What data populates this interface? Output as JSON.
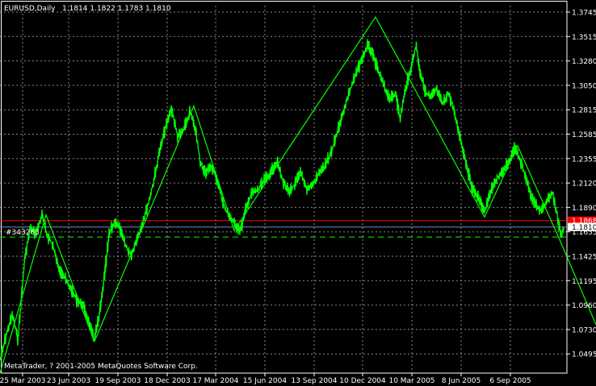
{
  "header": {
    "symbol_timeframe": "EURUSD,Daily",
    "ohlc": "1.1814 1.1822 1.1783 1.1810"
  },
  "copyright": "MetaTrader, ? 2001-2005 MetaQuotes Software Corp.",
  "order_label": "#343263",
  "price_labels": {
    "red_line": "1.1868",
    "current": "1.1810"
  },
  "colors": {
    "background": "#000000",
    "price_series": "#00ff00",
    "grid": "#b4b4b4",
    "axis_text": "#ffffff",
    "red_line": "#ff0000",
    "current_line": "#6a8fc7",
    "dashed_level": "#00ff00"
  },
  "chart_data": {
    "type": "line",
    "grid": true,
    "x_tick_labels": [
      "25 Mar 2003",
      "23 Jun 2003",
      "19 Sep 2003",
      "18 Dec 2003",
      "17 Mar 2004",
      "15 Jun 2004",
      "13 Sep 2004",
      "10 Dec 2004",
      "10 Mar 2005",
      "8 Jun 2005",
      "6 Sep 2005"
    ],
    "y_tick_labels": [
      "1.3745",
      "1.3515",
      "1.3280",
      "1.3050",
      "1.2815",
      "1.2585",
      "1.2355",
      "1.2120",
      "1.1890",
      "1.1655",
      "1.1425",
      "1.1195",
      "1.0960",
      "1.0730",
      "1.0495"
    ],
    "ylim": [
      1.0495,
      1.3745
    ],
    "price_path": [
      [
        0,
        1.062
      ],
      [
        8,
        1.085
      ],
      [
        15,
        1.102
      ],
      [
        22,
        1.08
      ],
      [
        30,
        1.15
      ],
      [
        37,
        1.18
      ],
      [
        44,
        1.175
      ],
      [
        52,
        1.192
      ],
      [
        58,
        1.174
      ],
      [
        65,
        1.165
      ],
      [
        72,
        1.145
      ],
      [
        80,
        1.135
      ],
      [
        88,
        1.125
      ],
      [
        95,
        1.115
      ],
      [
        103,
        1.11
      ],
      [
        110,
        1.095
      ],
      [
        116,
        1.08
      ],
      [
        122,
        1.098
      ],
      [
        128,
        1.13
      ],
      [
        135,
        1.175
      ],
      [
        142,
        1.186
      ],
      [
        148,
        1.18
      ],
      [
        155,
        1.165
      ],
      [
        162,
        1.155
      ],
      [
        168,
        1.168
      ],
      [
        175,
        1.182
      ],
      [
        182,
        1.198
      ],
      [
        190,
        1.222
      ],
      [
        197,
        1.248
      ],
      [
        204,
        1.268
      ],
      [
        212,
        1.288
      ],
      [
        220,
        1.262
      ],
      [
        228,
        1.27
      ],
      [
        235,
        1.285
      ],
      [
        242,
        1.268
      ],
      [
        248,
        1.238
      ],
      [
        255,
        1.23
      ],
      [
        262,
        1.236
      ],
      [
        270,
        1.22
      ],
      [
        278,
        1.198
      ],
      [
        285,
        1.19
      ],
      [
        292,
        1.182
      ],
      [
        298,
        1.178
      ],
      [
        305,
        1.2
      ],
      [
        312,
        1.212
      ],
      [
        320,
        1.215
      ],
      [
        328,
        1.224
      ],
      [
        335,
        1.23
      ],
      [
        343,
        1.24
      ],
      [
        350,
        1.222
      ],
      [
        358,
        1.212
      ],
      [
        365,
        1.22
      ],
      [
        372,
        1.23
      ],
      [
        380,
        1.215
      ],
      [
        388,
        1.22
      ],
      [
        395,
        1.23
      ],
      [
        402,
        1.236
      ],
      [
        410,
        1.248
      ],
      [
        418,
        1.268
      ],
      [
        425,
        1.285
      ],
      [
        432,
        1.302
      ],
      [
        440,
        1.318
      ],
      [
        448,
        1.332
      ],
      [
        455,
        1.345
      ],
      [
        462,
        1.335
      ],
      [
        470,
        1.318
      ],
      [
        477,
        1.305
      ],
      [
        483,
        1.296
      ],
      [
        490,
        1.302
      ],
      [
        495,
        1.278
      ],
      [
        502,
        1.306
      ],
      [
        508,
        1.322
      ],
      [
        515,
        1.345
      ],
      [
        520,
        1.32
      ],
      [
        527,
        1.302
      ],
      [
        533,
        1.298
      ],
      [
        540,
        1.305
      ],
      [
        548,
        1.292
      ],
      [
        555,
        1.302
      ],
      [
        562,
        1.285
      ],
      [
        570,
        1.26
      ],
      [
        578,
        1.235
      ],
      [
        585,
        1.215
      ],
      [
        592,
        1.208
      ],
      [
        600,
        1.195
      ],
      [
        607,
        1.212
      ],
      [
        615,
        1.225
      ],
      [
        622,
        1.23
      ],
      [
        630,
        1.24
      ],
      [
        637,
        1.252
      ],
      [
        642,
        1.245
      ],
      [
        650,
        1.228
      ],
      [
        657,
        1.21
      ],
      [
        664,
        1.2
      ],
      [
        670,
        1.195
      ],
      [
        677,
        1.205
      ],
      [
        684,
        1.212
      ],
      [
        690,
        1.19
      ],
      [
        695,
        1.172
      ],
      [
        698,
        1.181
      ]
    ],
    "zigzag": [
      [
        0,
        1.0495
      ],
      [
        57,
        1.192
      ],
      [
        117,
        1.078
      ],
      [
        240,
        1.29
      ],
      [
        290,
        1.178
      ],
      [
        465,
        1.37
      ],
      [
        600,
        1.19
      ],
      [
        641,
        1.254
      ],
      [
        694,
        1.168
      ],
      [
        738,
        1.093
      ]
    ],
    "levels": {
      "red_line": 1.1868,
      "current": 1.181,
      "dashed": 1.172
    }
  }
}
